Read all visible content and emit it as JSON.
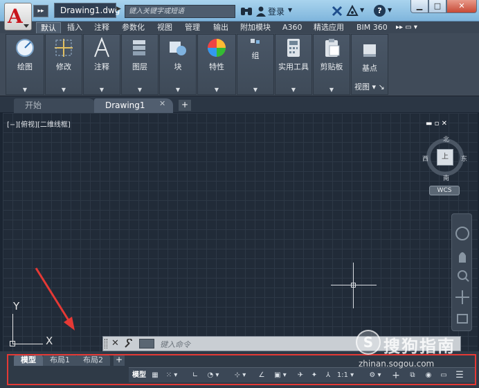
{
  "title_bar": {
    "doc_title": "Drawing1.dwg",
    "search_placeholder": "键入关键字或短语",
    "login_label": "登录"
  },
  "ribbon": {
    "tabs": [
      "默认",
      "插入",
      "注释",
      "参数化",
      "视图",
      "管理",
      "输出",
      "附加模块",
      "A360",
      "精选应用",
      "BIM 360"
    ],
    "active_tab": "默认",
    "panels": [
      "绘图",
      "修改",
      "注释",
      "图层",
      "块",
      "特性",
      "组",
      "实用工具",
      "剪贴板",
      "基点"
    ],
    "view_panel_label": "视图"
  },
  "file_tabs": {
    "start": "开始",
    "drawing": "Drawing1"
  },
  "canvas": {
    "viewport_label": "[−][俯视][二维线框]",
    "viewcube": {
      "north": "北",
      "south": "南",
      "east": "东",
      "west": "西",
      "face": "上",
      "wcs": "WCS"
    },
    "ucs": {
      "x": "X",
      "y": "Y"
    }
  },
  "command_line": {
    "placeholder": "键入命令"
  },
  "layout_tabs": [
    "模型",
    "布局1",
    "布局2"
  ],
  "status_bar": {
    "model": "模型",
    "scale": "1:1"
  },
  "watermark": {
    "brand": "搜狗指南",
    "url": "zhinan.sogou.com",
    "logo": "S"
  },
  "colors": {
    "highlight_border": "#e53935",
    "annotation_arrow": "#e53935",
    "app_logo_red": "#c8141c"
  }
}
